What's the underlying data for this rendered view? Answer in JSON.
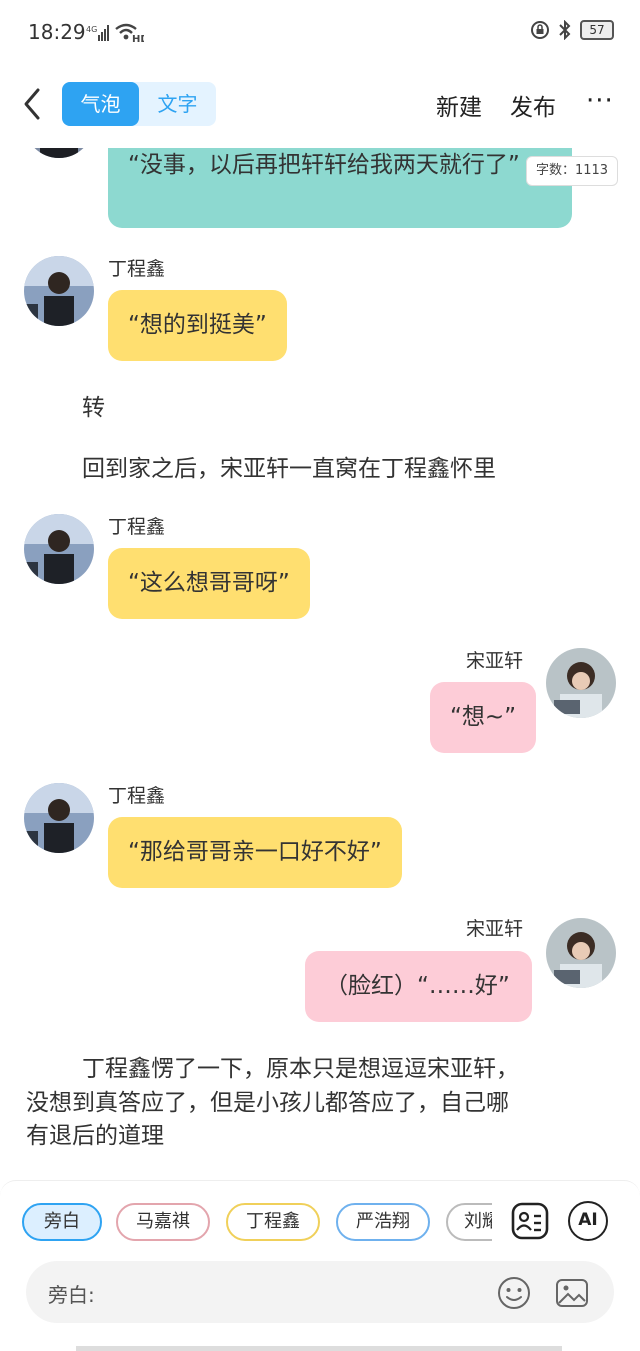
{
  "status": {
    "time": "18:29",
    "network": "4G",
    "wifi_badge": "HD",
    "battery": "57"
  },
  "header": {
    "mode_bubble": "气泡",
    "mode_text": "文字",
    "new_label": "新建",
    "publish_label": "发布",
    "more_label": "···"
  },
  "chat": {
    "top_teal_bubble": "“没事，以后再把轩轩给我两天就行了”",
    "word_count": "字数：1113",
    "msg1": {
      "name": "丁程鑫",
      "text": "“想的到挺美”"
    },
    "narration1": "转",
    "narration2": "回到家之后，宋亚轩一直窝在丁程鑫怀里",
    "msg2": {
      "name": "丁程鑫",
      "text": "“这么想哥哥呀”"
    },
    "msg3": {
      "name": "宋亚轩",
      "text": "“想~”"
    },
    "msg4": {
      "name": "丁程鑫",
      "text": "“那给哥哥亲一口好不好”"
    },
    "msg5": {
      "name": "宋亚轩",
      "text": "（脸红）“……好”"
    },
    "narration3_line1": "丁程鑫愣了一下，原本只是想逗逗宋亚轩，",
    "narration3_line2": "没想到真答应了，但是小孩儿都答应了，自己哪",
    "narration3_line3": "有退后的道理"
  },
  "roles": [
    "旁白",
    "马嘉祺",
    "丁程鑫",
    "严浩翔",
    "刘耀文"
  ],
  "input": {
    "label": "旁白:",
    "value": ""
  },
  "ai_label": "AI",
  "colors": {
    "accent": "#2ea3f2",
    "yellow": "#ffdf70",
    "pink": "#fdccd7",
    "teal": "#8dd9d0"
  }
}
